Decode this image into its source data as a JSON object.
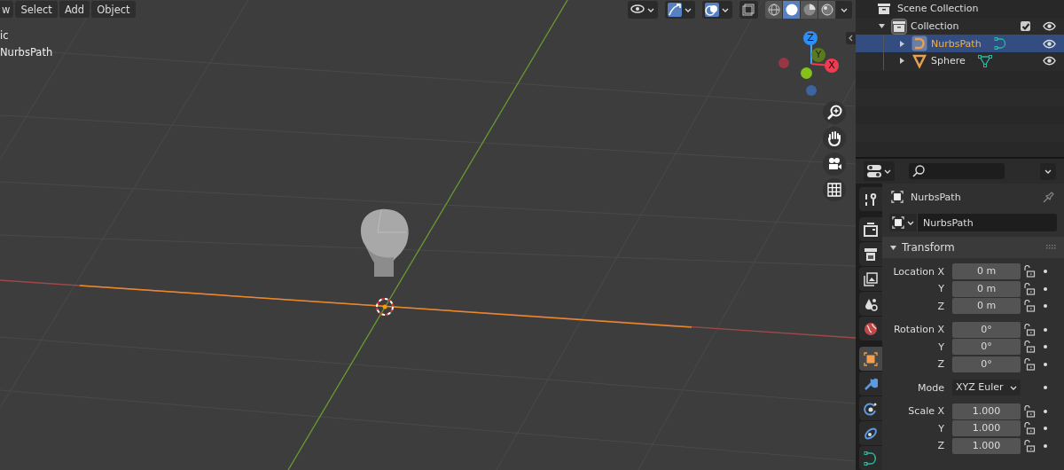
{
  "viewport": {
    "menus": [
      {
        "label": "w"
      },
      {
        "label": "Select"
      },
      {
        "label": "Add"
      },
      {
        "label": "Object"
      }
    ],
    "overlay_text": [
      "ic",
      "NurbsPath"
    ],
    "header_toggles": [
      {
        "kind": "visibility",
        "on": false
      },
      {
        "kind": "gizmo",
        "on": true
      },
      {
        "kind": "overlay",
        "on": true
      },
      {
        "kind": "xray",
        "on": false
      }
    ],
    "shading_modes": [
      {
        "kind": "wireframe",
        "selected": false
      },
      {
        "kind": "solid",
        "selected": true
      },
      {
        "kind": "material",
        "selected": false
      },
      {
        "kind": "rendered",
        "selected": false
      }
    ],
    "gizmo_axes": [
      "Z",
      "Y",
      "X"
    ],
    "nav_buttons": [
      {
        "kind": "zoom"
      },
      {
        "kind": "pan"
      },
      {
        "kind": "camera"
      },
      {
        "kind": "ortho"
      }
    ]
  },
  "outliner": {
    "root": {
      "label": "Scene Collection",
      "children": [
        {
          "label": "Collection",
          "kind": "collection",
          "expanded": true,
          "checked": true,
          "visible": true,
          "selected": false,
          "children": [
            {
              "label": "NurbsPath",
              "kind": "curve",
              "expanded": false,
              "visible": true,
              "selected": true
            },
            {
              "label": "Sphere",
              "kind": "mesh",
              "expanded": false,
              "visible": true,
              "selected": false
            }
          ]
        }
      ]
    }
  },
  "properties": {
    "tabs": [
      {
        "kind": "tool",
        "selected": false
      },
      {
        "kind": "render",
        "selected": false
      },
      {
        "kind": "output",
        "selected": false
      },
      {
        "kind": "view_layer",
        "selected": false
      },
      {
        "kind": "scene",
        "selected": false
      },
      {
        "kind": "world",
        "selected": false
      },
      {
        "kind": "object",
        "selected": true
      },
      {
        "kind": "modifier",
        "selected": false
      },
      {
        "kind": "particles",
        "selected": false
      },
      {
        "kind": "physics",
        "selected": false
      },
      {
        "kind": "data",
        "selected": false
      }
    ],
    "object_name": "NurbsPath",
    "name_field": "NurbsPath",
    "panel": {
      "title": "Transform",
      "expanded": true,
      "rows": [
        {
          "label": "Location X",
          "value": "0 m",
          "kind": "number",
          "gap": false
        },
        {
          "label": "Y",
          "value": "0 m",
          "kind": "number",
          "gap": false
        },
        {
          "label": "Z",
          "value": "0 m",
          "kind": "number",
          "gap": false
        },
        {
          "label": "Rotation X",
          "value": "0°",
          "kind": "number",
          "gap": true
        },
        {
          "label": "Y",
          "value": "0°",
          "kind": "number",
          "gap": false
        },
        {
          "label": "Z",
          "value": "0°",
          "kind": "number",
          "gap": false
        },
        {
          "label": "Mode",
          "value": "XYZ Euler",
          "kind": "dropdown",
          "gap": true
        },
        {
          "label": "Scale X",
          "value": "1.000",
          "kind": "number",
          "gap": true
        },
        {
          "label": "Y",
          "value": "1.000",
          "kind": "number",
          "gap": false
        },
        {
          "label": "Z",
          "value": "1.000",
          "kind": "number",
          "gap": false
        }
      ]
    }
  }
}
